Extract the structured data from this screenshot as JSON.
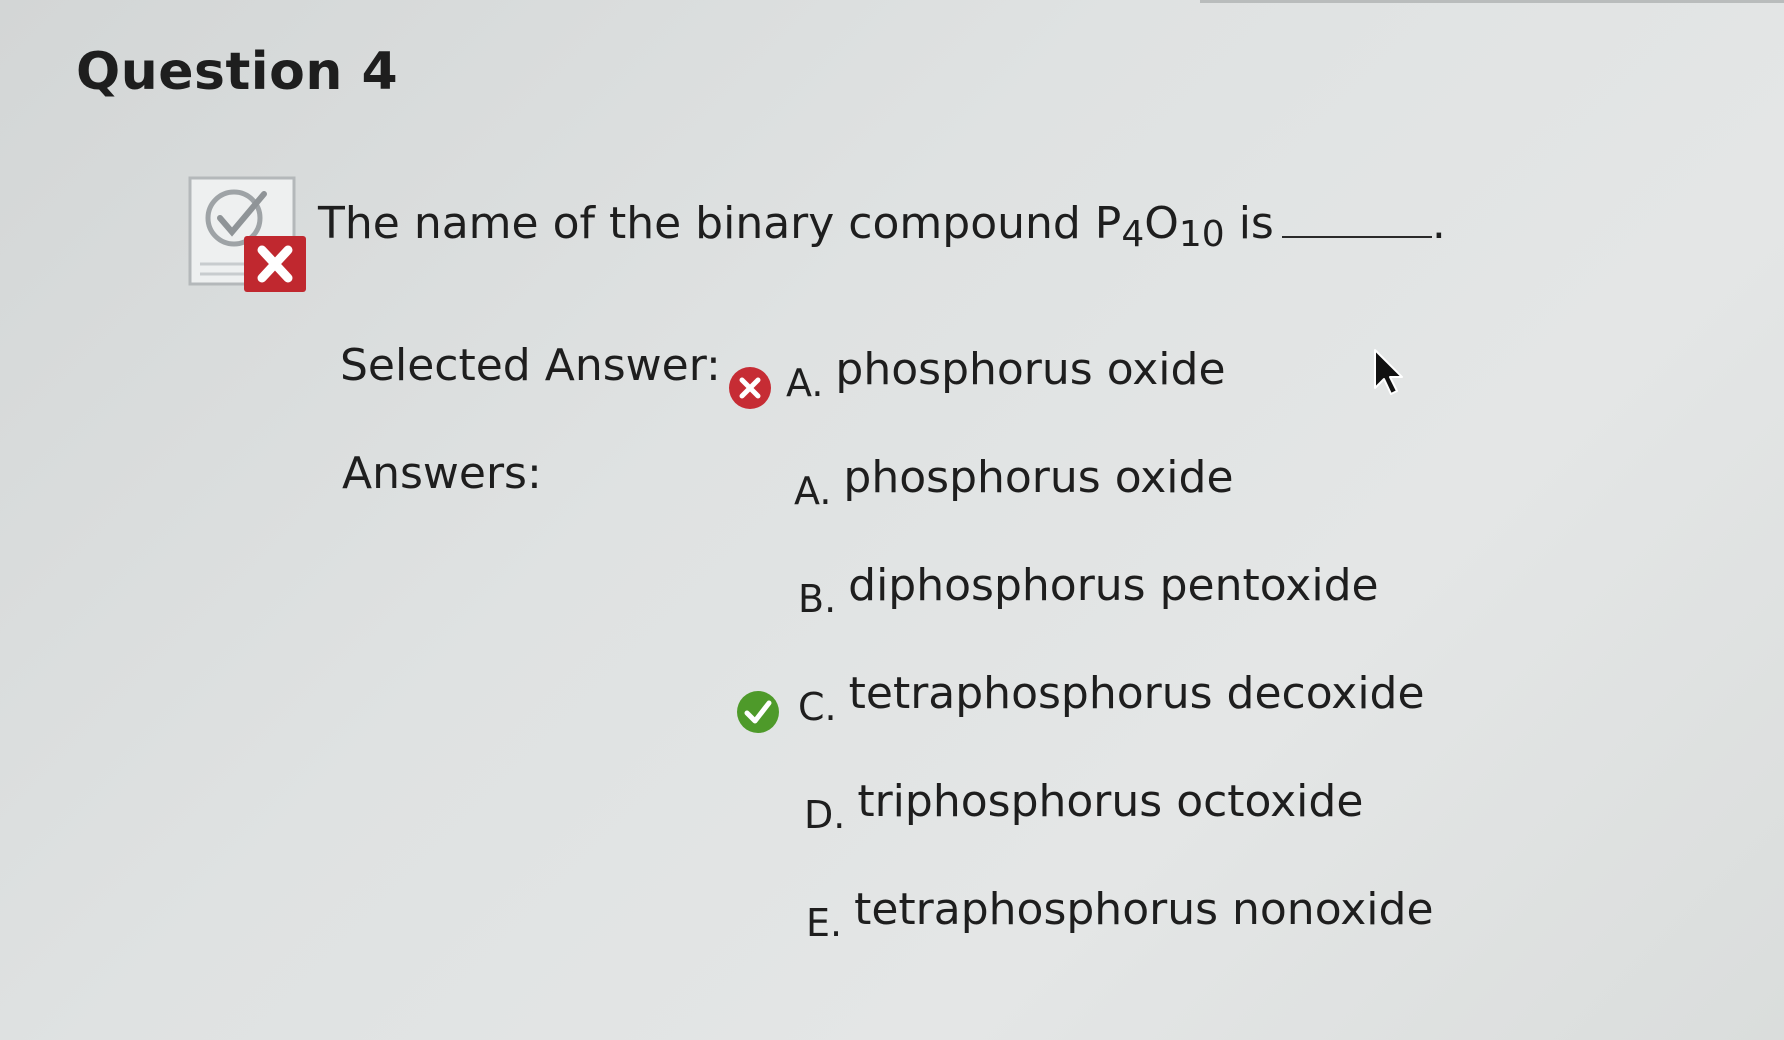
{
  "question": {
    "title": "Question 4",
    "text_prefix": "The name of the binary compound P",
    "sub1": "4",
    "text_mid": "O",
    "sub2": "10",
    "text_suffix": " is",
    "period": ".",
    "status_icon": "incorrect-badge-icon"
  },
  "selected": {
    "label": "Selected Answer:",
    "icon": "incorrect-icon",
    "letter": "A.",
    "text": "phosphorus oxide"
  },
  "answers": {
    "label": "Answers:",
    "items": [
      {
        "letter": "A.",
        "text": "phosphorus oxide"
      },
      {
        "letter": "B.",
        "text": "diphosphorus pentoxide"
      },
      {
        "letter": "C.",
        "text": "tetraphosphorus decoxide",
        "icon": "correct-icon"
      },
      {
        "letter": "D.",
        "text": "triphosphorus octoxide"
      },
      {
        "letter": "E.",
        "text": "tetraphosphorus nonoxide"
      }
    ]
  },
  "colors": {
    "incorrect": "#c62c34",
    "correct": "#4e9a2a",
    "background": "#dfe2e2"
  }
}
